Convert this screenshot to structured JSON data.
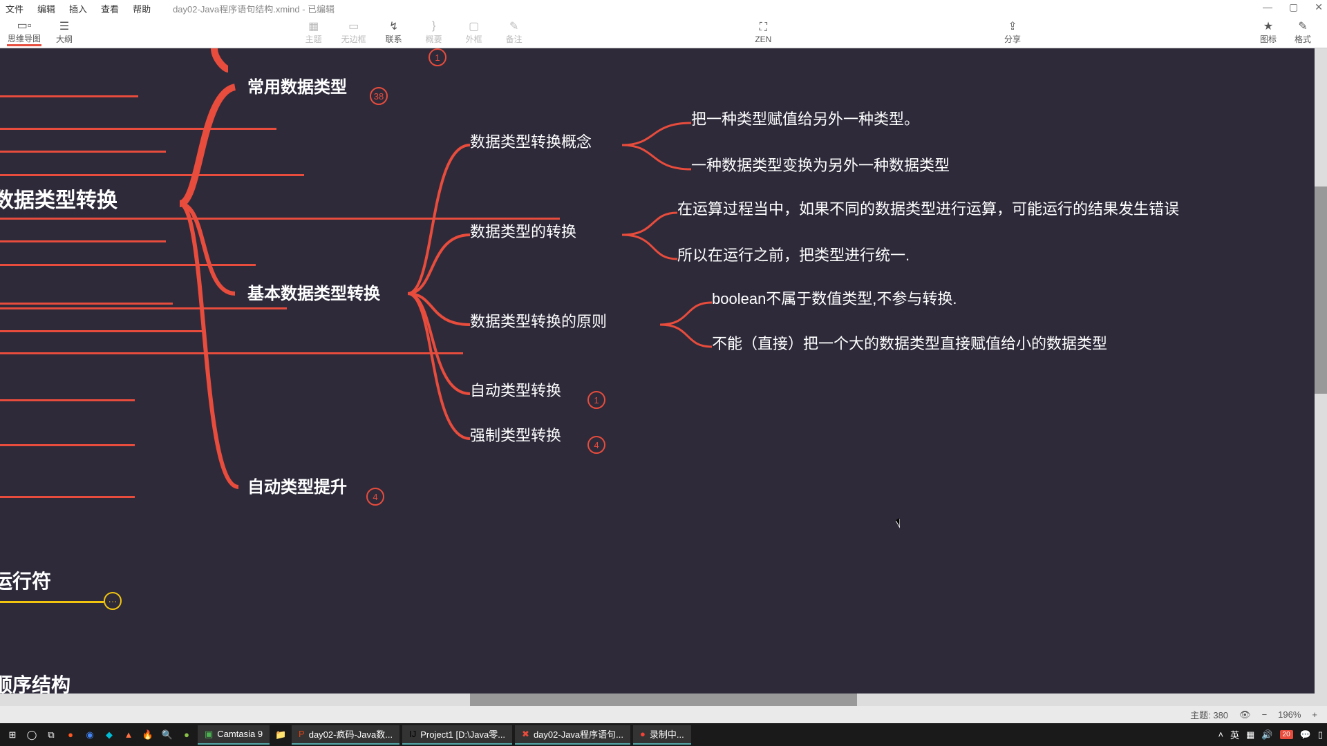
{
  "app": {
    "title": "day02-Java程序语句结构.xmind - 已编辑"
  },
  "menu": {
    "file": "文件",
    "edit": "编辑",
    "insert": "插入",
    "view": "查看",
    "help": "帮助"
  },
  "toolbar": {
    "mindmap": "思维导图",
    "outline": "大纲",
    "theme": "主题",
    "uncollapse": "无边框",
    "relation": "联系",
    "summary": "概要",
    "boundary": "外框",
    "note": "备注",
    "zen": "ZEN",
    "share": "分享",
    "icon": "图标",
    "style": "格式"
  },
  "nodes": {
    "rootA": "数据类型转换",
    "rootB": "运行符",
    "rootC": "顺序结构",
    "common": "常用数据类型",
    "basic": "基本数据类型转换",
    "autoUp": "自动类型提升",
    "concept": "数据类型转换概念",
    "concept1": "把一种类型赋值给另外一种类型。",
    "concept2": "一种数据类型变换为另外一种数据类型",
    "conv": "数据类型的转换",
    "conv1": "在运算过程当中，如果不同的数据类型进行运算，可能运行的结果发生错误",
    "conv2": "所以在运行之前，把类型进行统一.",
    "rule": "数据类型转换的原则",
    "rule1": "boolean不属于数值类型,不参与转换.",
    "rule2": "不能（直接）把一个大的数据类型直接赋值给小的数据类型",
    "auto": "自动类型转换",
    "force": "强制类型转换"
  },
  "badges": {
    "top": "1",
    "common": "38",
    "auto": "1",
    "force": "4",
    "autoUp": "4",
    "rootB": "···"
  },
  "status": {
    "topics": "主题: 380",
    "eye": "👁",
    "zoom": "196%"
  },
  "taskbar": {
    "camtasia": "Camtasia 9",
    "ppt": "day02-疯码-Java数...",
    "idea": "Project1 [D:\\Java零...",
    "xmind": "day02-Java程序语句...",
    "rec": "录制中..."
  },
  "tray": {
    "ime": "英",
    "date": "20"
  },
  "chart_data": {
    "type": "mindmap",
    "title": "day02-Java程序语句结构",
    "roots": [
      {
        "label": "数据类型转换",
        "children": [
          {
            "label": "常用数据类型",
            "badge": 38
          },
          {
            "label": "基本数据类型转换",
            "children": [
              {
                "label": "数据类型转换概念",
                "children": [
                  {
                    "label": "把一种类型赋值给另外一种类型。"
                  },
                  {
                    "label": "一种数据类型变换为另外一种数据类型"
                  }
                ]
              },
              {
                "label": "数据类型的转换",
                "children": [
                  {
                    "label": "在运算过程当中，如果不同的数据类型进行运算，可能运行的结果发生错误"
                  },
                  {
                    "label": "所以在运行之前，把类型进行统一."
                  }
                ]
              },
              {
                "label": "数据类型转换的原则",
                "children": [
                  {
                    "label": "boolean不属于数值类型,不参与转换."
                  },
                  {
                    "label": "不能（直接）把一个大的数据类型直接赋值给小的数据类型"
                  }
                ]
              },
              {
                "label": "自动类型转换",
                "badge": 1
              },
              {
                "label": "强制类型转换",
                "badge": 4
              }
            ]
          },
          {
            "label": "自动类型提升",
            "badge": 4
          }
        ]
      },
      {
        "label": "运行符",
        "collapsed": true
      },
      {
        "label": "顺序结构",
        "collapsed": true
      }
    ]
  }
}
